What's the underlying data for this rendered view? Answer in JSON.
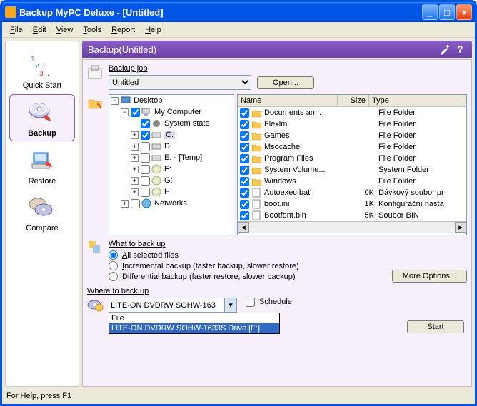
{
  "titlebar": {
    "text": "Backup MyPC Deluxe - [Untitled]"
  },
  "menu": {
    "file": "File",
    "edit": "Edit",
    "view": "View",
    "tools": "Tools",
    "report": "Report",
    "help": "Help"
  },
  "sidebar": {
    "items": [
      {
        "label": "Quick Start"
      },
      {
        "label": "Backup"
      },
      {
        "label": "Restore"
      },
      {
        "label": "Compare"
      }
    ]
  },
  "panel": {
    "title": "Backup(Untitled)"
  },
  "job": {
    "label": "Backup job",
    "value": "Untitled",
    "open": "Open..."
  },
  "tree": {
    "desktop": "Desktop",
    "mycomputer": "My Computer",
    "systemstate": "System state",
    "c": "C:",
    "d": "D:",
    "e": "E: - [Temp]",
    "f": "F:",
    "g": "G:",
    "h": "H:",
    "networks": "Networks"
  },
  "list": {
    "headers": {
      "name": "Name",
      "size": "Size",
      "type": "Type"
    },
    "rows": [
      {
        "name": "Documents an...",
        "size": "",
        "type": "File Folder"
      },
      {
        "name": "Flexlm",
        "size": "",
        "type": "File Folder"
      },
      {
        "name": "Games",
        "size": "",
        "type": "File Folder"
      },
      {
        "name": "Msocache",
        "size": "",
        "type": "File Folder"
      },
      {
        "name": "Program Files",
        "size": "",
        "type": "File Folder"
      },
      {
        "name": "System Volume...",
        "size": "",
        "type": "System Folder"
      },
      {
        "name": "Windows",
        "size": "",
        "type": "File Folder"
      },
      {
        "name": "Autoexec.bat",
        "size": "0K",
        "type": "Dávkový soubor pr"
      },
      {
        "name": "boot.ini",
        "size": "1K",
        "type": "Konfigurační nasta"
      },
      {
        "name": "Bootfont.bin",
        "size": "5K",
        "type": "Soubor BIN"
      }
    ]
  },
  "what": {
    "label": "What to back up",
    "all": "All selected files",
    "incremental": "Incremental backup (faster backup, slower restore)",
    "differential": "Differential backup (faster restore, slower backup)",
    "more": "More Options..."
  },
  "where": {
    "label": "Where to back up",
    "value": "LITE-ON DVDRW SOHW-163",
    "schedule": "Schedule",
    "options": [
      "File",
      "LITE-ON DVDRW SOHW-1633S Drive [F:]"
    ]
  },
  "start": "Start",
  "status": "For Help, press F1"
}
